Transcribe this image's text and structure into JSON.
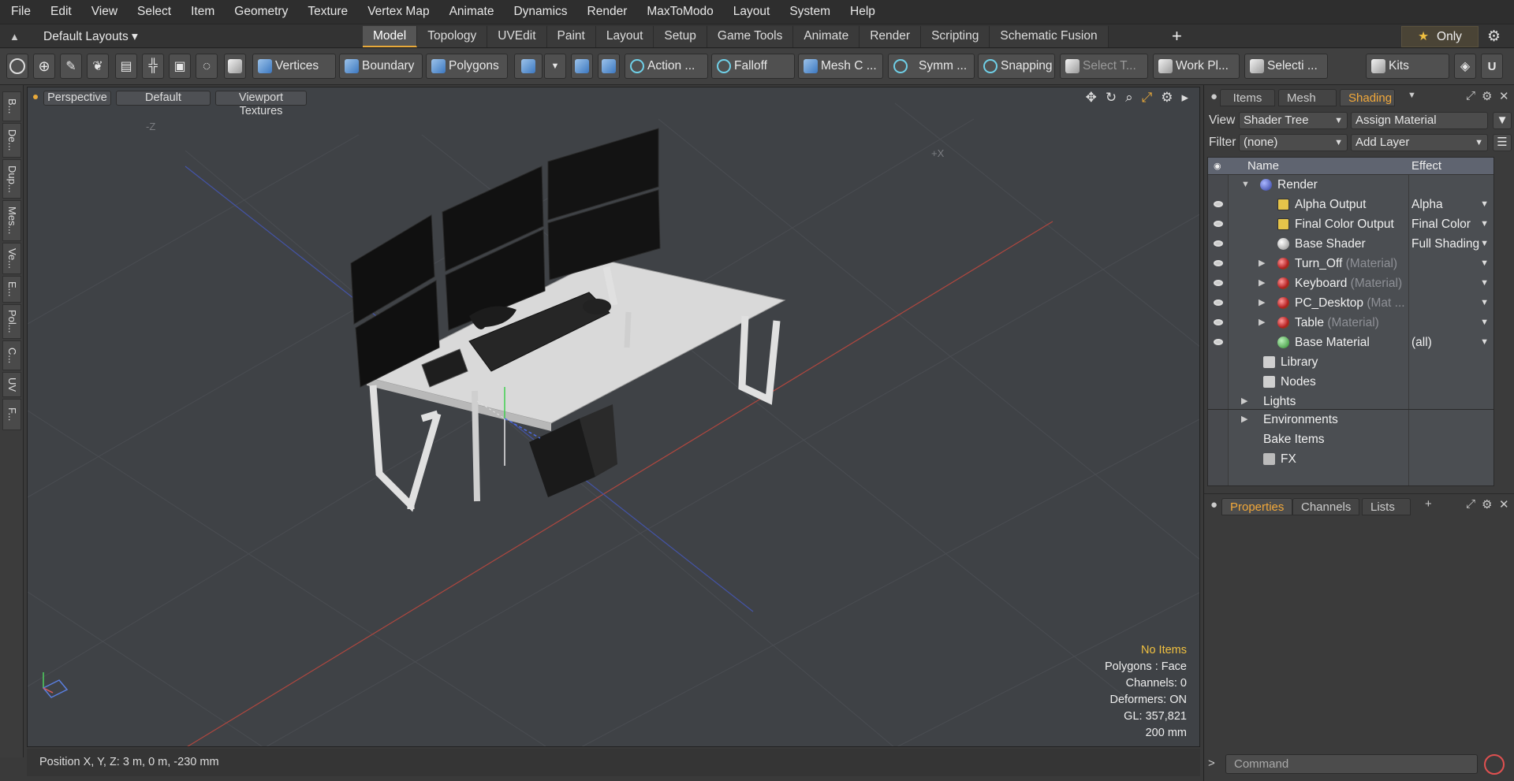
{
  "menu": [
    "File",
    "Edit",
    "View",
    "Select",
    "Item",
    "Geometry",
    "Texture",
    "Vertex Map",
    "Animate",
    "Dynamics",
    "Render",
    "MaxToModo",
    "Layout",
    "System",
    "Help"
  ],
  "layout_bar": {
    "default_layouts": "Default Layouts ▾",
    "tabs": [
      "Model",
      "Topology",
      "UVEdit",
      "Paint",
      "Layout",
      "Setup",
      "Game Tools",
      "Animate",
      "Render",
      "Scripting",
      "Schematic Fusion"
    ],
    "active_tab": "Model",
    "add_tab": "+",
    "only_label": "Only"
  },
  "toolbar": {
    "vertices": "Vertices",
    "boundary": "Boundary",
    "polygons": "Polygons",
    "action": "Action ...",
    "falloff": "Falloff",
    "mesh": "Mesh C ...",
    "symm": "Symm ...",
    "snapping": "Snapping",
    "select_t": "Select T...",
    "work_pl": "Work Pl...",
    "selecti": "Selecti ...",
    "kits": "Kits"
  },
  "left_strip": [
    "B...",
    "De...",
    "Dup...",
    "Mes...",
    "Ve...",
    "E...",
    "Pol...",
    "C...",
    "UV",
    "F..."
  ],
  "viewport": {
    "perspective": "Perspective",
    "default": "Default",
    "textures": "Viewport Textures",
    "axis_neg_z": "-Z",
    "axis_pos_x": "+X",
    "info": {
      "no_items": "No Items",
      "polygons": "Polygons : Face",
      "channels": "Channels: 0",
      "deformers": "Deformers: ON",
      "gl": "GL: 357,821",
      "scale": "200 mm"
    }
  },
  "status": {
    "position": "Position X, Y, Z:   3 m, 0 m, -230 mm"
  },
  "right_panel": {
    "tabs": [
      "Items",
      "Mesh ...",
      "Shading"
    ],
    "active": "Shading",
    "view_label": "View",
    "view_value": "Shader Tree",
    "assign": "Assign Material",
    "filter_label": "Filter",
    "filter_value": "(none)",
    "add_layer": "Add Layer",
    "col_name": "Name",
    "col_effect": "Effect",
    "rows": [
      {
        "name": "Render",
        "sub": "",
        "effect": ""
      },
      {
        "name": "Alpha Output",
        "sub": "",
        "effect": "Alpha"
      },
      {
        "name": "Final Color Output",
        "sub": "",
        "effect": "Final Color"
      },
      {
        "name": "Base Shader",
        "sub": "",
        "effect": "Full Shading"
      },
      {
        "name": "Turn_Off",
        "sub": "(Material)",
        "effect": ""
      },
      {
        "name": "Keyboard",
        "sub": "(Material)",
        "effect": ""
      },
      {
        "name": "PC_Desktop",
        "sub": "(Mat ...",
        "effect": ""
      },
      {
        "name": "Table",
        "sub": "(Material)",
        "effect": ""
      },
      {
        "name": "Base Material",
        "sub": "",
        "effect": "(all)"
      },
      {
        "name": "Library",
        "sub": "",
        "effect": ""
      },
      {
        "name": "Nodes",
        "sub": "",
        "effect": ""
      },
      {
        "name": "Lights",
        "sub": "",
        "effect": ""
      },
      {
        "name": "Environments",
        "sub": "",
        "effect": ""
      },
      {
        "name": "Bake Items",
        "sub": "",
        "effect": ""
      },
      {
        "name": "FX",
        "sub": "",
        "effect": ""
      }
    ],
    "props_tabs": [
      "Properties",
      "Channels",
      "Lists"
    ],
    "props_active": "Properties",
    "props_add": "+"
  },
  "command": {
    "placeholder": "Command",
    "prompt": ">"
  }
}
